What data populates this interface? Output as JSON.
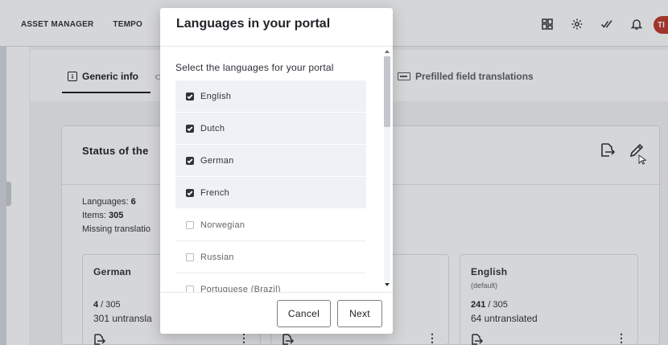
{
  "topnav": {
    "items": [
      "ASSET MANAGER",
      "TEMPO"
    ],
    "avatar": "TI"
  },
  "tabs": {
    "generic": "Generic info",
    "prefilled": "Prefilled field translations"
  },
  "status": {
    "title": "Status of the",
    "languages_label": "Languages:",
    "languages_value": "6",
    "items_label": "Items:",
    "items_value": "305",
    "missing_label": "Missing translatio"
  },
  "cards": [
    {
      "name": "German",
      "sub": "",
      "count": "4",
      "total": " / 305",
      "untranslated": "301 untransla"
    },
    {
      "name": "English",
      "sub": "(default)",
      "count": "241",
      "total": " / 305",
      "untranslated": "64 untranslated"
    }
  ],
  "modal": {
    "title": "Languages in your portal",
    "subtitle": "Select the languages for your portal",
    "languages": [
      {
        "label": "English",
        "checked": true
      },
      {
        "label": "Dutch",
        "checked": true
      },
      {
        "label": "German",
        "checked": true
      },
      {
        "label": "French",
        "checked": true
      },
      {
        "label": "Norwegian",
        "checked": false
      },
      {
        "label": "Russian",
        "checked": false
      },
      {
        "label": "Portuguese (Brazil)",
        "checked": false
      }
    ],
    "cancel_label": "Cancel",
    "next_label": "Next"
  },
  "colors": {
    "avatar": "#c0392b",
    "checkbox": "#2e3338",
    "row_selected": "#eef1f5"
  }
}
